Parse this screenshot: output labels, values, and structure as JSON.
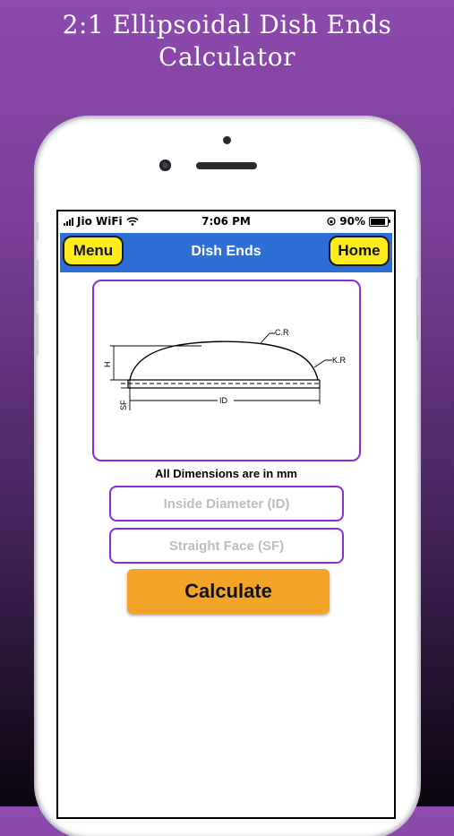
{
  "promo": {
    "title_line1": "2:1 Ellipsoidal Dish Ends",
    "title_line2": "Calculator"
  },
  "status_bar": {
    "carrier": "Jio WiFi",
    "time": "7:06 PM",
    "battery_percent": "90%",
    "battery_level": 0.9,
    "icons": [
      "signal-icon",
      "wifi-icon",
      "orientation-lock-icon",
      "battery-icon"
    ]
  },
  "navbar": {
    "menu_label": "Menu",
    "title": "Dish Ends",
    "home_label": "Home"
  },
  "diagram": {
    "labels": {
      "crown_radius": "C.R",
      "knuckle_radius": "K.R",
      "height": "H",
      "straight_face": "SF",
      "inside_diameter": "ID"
    }
  },
  "form": {
    "units_note": "All Dimensions are in mm",
    "inside_diameter_placeholder": "Inside Diameter (ID)",
    "straight_face_placeholder": "Straight Face (SF)",
    "calculate_label": "Calculate"
  },
  "colors": {
    "navbar": "#2d6fd4",
    "nav_button": "#ffec1a",
    "frame_border": "#8a2be2",
    "calculate_button": "#f2a328"
  }
}
